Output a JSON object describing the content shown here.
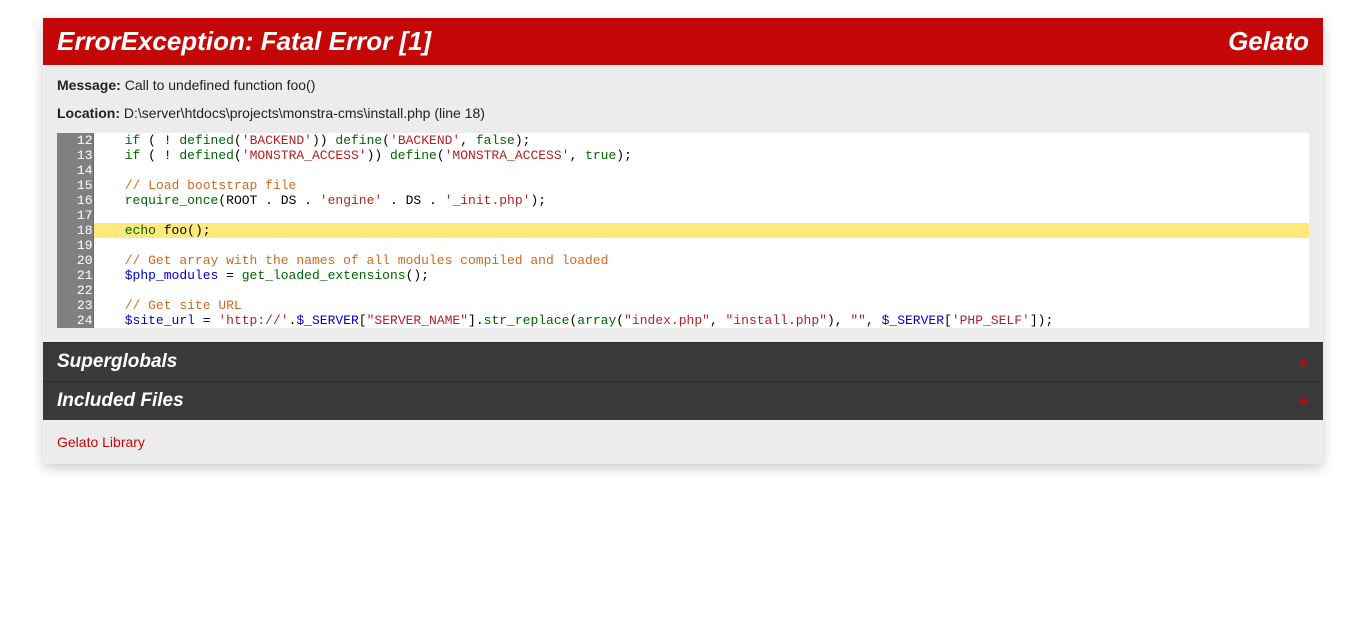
{
  "header": {
    "title_prefix": "ErrorException: Fatal Error ",
    "title_code": "[1]",
    "brand": "Gelato"
  },
  "message_label": "Message:",
  "message_text": " Call to undefined function foo()",
  "location_label": "Location:",
  "location_text": " D:\\server\\htdocs\\projects\\monstra-cms\\install.php (line 18)",
  "code": {
    "highlight_line": 18,
    "lines": [
      {
        "n": 12,
        "tokens": [
          {
            "t": "    ",
            "c": "plain"
          },
          {
            "t": "if",
            "c": "kw"
          },
          {
            "t": " ( ! ",
            "c": "plain"
          },
          {
            "t": "defined",
            "c": "kw"
          },
          {
            "t": "(",
            "c": "plain"
          },
          {
            "t": "'BACKEND'",
            "c": "str"
          },
          {
            "t": ")) ",
            "c": "plain"
          },
          {
            "t": "define",
            "c": "kw"
          },
          {
            "t": "(",
            "c": "plain"
          },
          {
            "t": "'BACKEND'",
            "c": "str"
          },
          {
            "t": ", ",
            "c": "plain"
          },
          {
            "t": "false",
            "c": "kw"
          },
          {
            "t": ");",
            "c": "plain"
          }
        ]
      },
      {
        "n": 13,
        "tokens": [
          {
            "t": "    ",
            "c": "plain"
          },
          {
            "t": "if",
            "c": "kw"
          },
          {
            "t": " ( ! ",
            "c": "plain"
          },
          {
            "t": "defined",
            "c": "kw"
          },
          {
            "t": "(",
            "c": "plain"
          },
          {
            "t": "'MONSTRA_ACCESS'",
            "c": "str"
          },
          {
            "t": ")) ",
            "c": "plain"
          },
          {
            "t": "define",
            "c": "kw"
          },
          {
            "t": "(",
            "c": "plain"
          },
          {
            "t": "'MONSTRA_ACCESS'",
            "c": "str"
          },
          {
            "t": ", ",
            "c": "plain"
          },
          {
            "t": "true",
            "c": "kw"
          },
          {
            "t": ");",
            "c": "plain"
          }
        ]
      },
      {
        "n": 14,
        "tokens": []
      },
      {
        "n": 15,
        "tokens": [
          {
            "t": "    ",
            "c": "plain"
          },
          {
            "t": "// Load bootstrap file",
            "c": "com"
          }
        ]
      },
      {
        "n": 16,
        "tokens": [
          {
            "t": "    ",
            "c": "plain"
          },
          {
            "t": "require_once",
            "c": "kw"
          },
          {
            "t": "(",
            "c": "plain"
          },
          {
            "t": "ROOT",
            "c": "plain"
          },
          {
            "t": " . ",
            "c": "plain"
          },
          {
            "t": "DS",
            "c": "plain"
          },
          {
            "t": " . ",
            "c": "plain"
          },
          {
            "t": "'engine'",
            "c": "str"
          },
          {
            "t": " . ",
            "c": "plain"
          },
          {
            "t": "DS",
            "c": "plain"
          },
          {
            "t": " . ",
            "c": "plain"
          },
          {
            "t": "'_init.php'",
            "c": "str"
          },
          {
            "t": ");",
            "c": "plain"
          }
        ]
      },
      {
        "n": 17,
        "tokens": []
      },
      {
        "n": 18,
        "tokens": [
          {
            "t": "    ",
            "c": "plain"
          },
          {
            "t": "echo",
            "c": "kw"
          },
          {
            "t": " ",
            "c": "plain"
          },
          {
            "t": "foo",
            "c": "plain"
          },
          {
            "t": "();",
            "c": "plain"
          }
        ]
      },
      {
        "n": 19,
        "tokens": []
      },
      {
        "n": 20,
        "tokens": [
          {
            "t": "    ",
            "c": "plain"
          },
          {
            "t": "// Get array with the names of all modules compiled and loaded",
            "c": "com"
          }
        ]
      },
      {
        "n": 21,
        "tokens": [
          {
            "t": "    ",
            "c": "plain"
          },
          {
            "t": "$php_modules",
            "c": "var"
          },
          {
            "t": " = ",
            "c": "plain"
          },
          {
            "t": "get_loaded_extensions",
            "c": "kw"
          },
          {
            "t": "();",
            "c": "plain"
          }
        ]
      },
      {
        "n": 22,
        "tokens": []
      },
      {
        "n": 23,
        "tokens": [
          {
            "t": "    ",
            "c": "plain"
          },
          {
            "t": "// Get site URL",
            "c": "com"
          }
        ]
      },
      {
        "n": 24,
        "tokens": [
          {
            "t": "    ",
            "c": "plain"
          },
          {
            "t": "$site_url",
            "c": "var"
          },
          {
            "t": " = ",
            "c": "plain"
          },
          {
            "t": "'http://'",
            "c": "str"
          },
          {
            "t": ".",
            "c": "plain"
          },
          {
            "t": "$_SERVER",
            "c": "var"
          },
          {
            "t": "[",
            "c": "plain"
          },
          {
            "t": "\"SERVER_NAME\"",
            "c": "str"
          },
          {
            "t": "].",
            "c": "plain"
          },
          {
            "t": "str_replace",
            "c": "kw"
          },
          {
            "t": "(",
            "c": "plain"
          },
          {
            "t": "array",
            "c": "kw"
          },
          {
            "t": "(",
            "c": "plain"
          },
          {
            "t": "\"index.php\"",
            "c": "str"
          },
          {
            "t": ", ",
            "c": "plain"
          },
          {
            "t": "\"install.php\"",
            "c": "str"
          },
          {
            "t": "), ",
            "c": "plain"
          },
          {
            "t": "\"\"",
            "c": "str"
          },
          {
            "t": ", ",
            "c": "plain"
          },
          {
            "t": "$_SERVER",
            "c": "var"
          },
          {
            "t": "[",
            "c": "plain"
          },
          {
            "t": "'PHP_SELF'",
            "c": "str"
          },
          {
            "t": "]);",
            "c": "plain"
          }
        ]
      }
    ]
  },
  "sections": [
    {
      "title": "Superglobals",
      "toggle": "+"
    },
    {
      "title": "Included Files",
      "toggle": "+"
    }
  ],
  "footer_link": "Gelato Library"
}
